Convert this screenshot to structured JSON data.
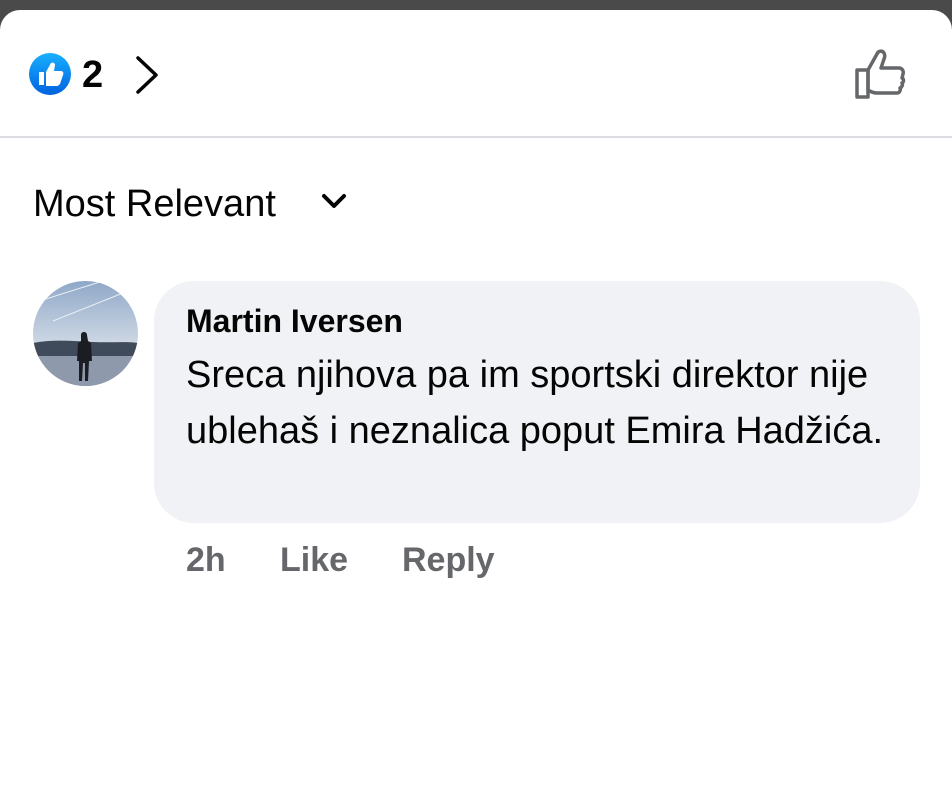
{
  "header": {
    "reaction_icon": "like-reaction-icon",
    "reaction_count": "2",
    "reactions_chevron": "chevron-right-icon",
    "like_button_icon": "thumbs-up-outline-icon",
    "brand_color": "#1877f2"
  },
  "sort": {
    "label": "Most Relevant",
    "icon": "chevron-down-icon"
  },
  "comments": [
    {
      "author": "Martin Iversen",
      "text": "Sreca njihova pa im sportski direktor nije ublehaš i neznalica poput Emira Hadžića.",
      "time": "2h",
      "like_label": "Like",
      "reply_label": "Reply"
    }
  ]
}
